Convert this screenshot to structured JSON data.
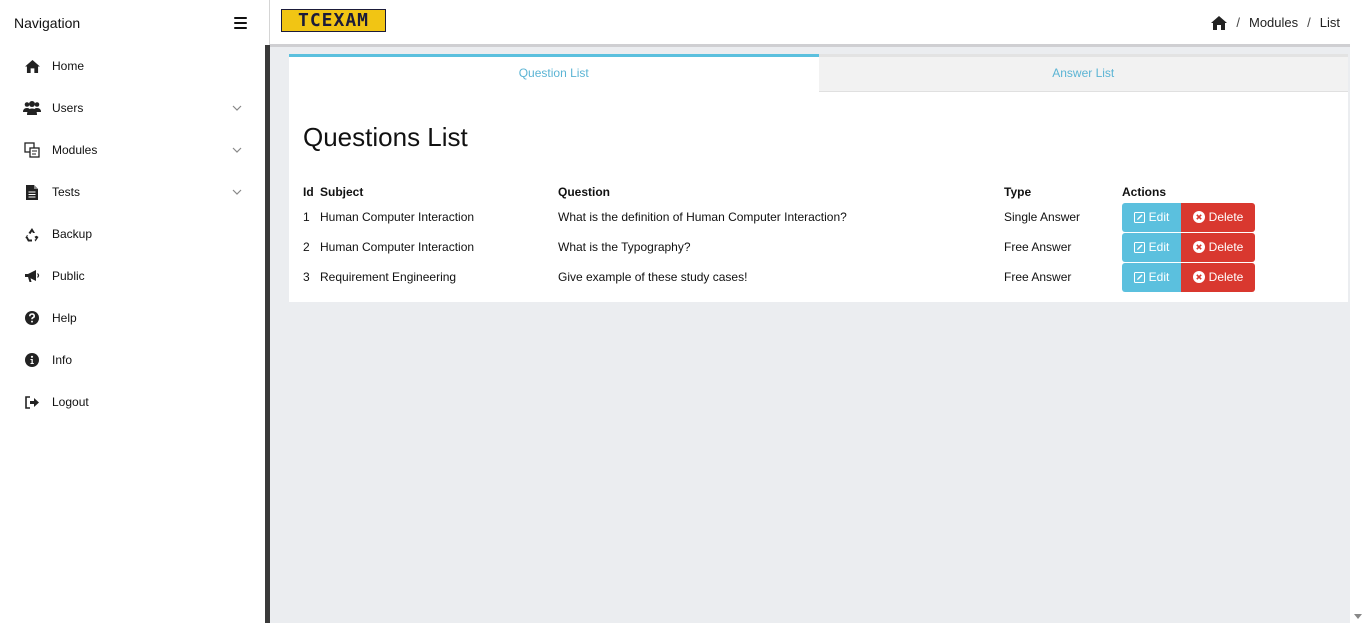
{
  "sidebar": {
    "title": "Navigation",
    "items": [
      {
        "label": "Home",
        "icon": "home-icon"
      },
      {
        "label": "Users",
        "icon": "users-icon",
        "expandable": true
      },
      {
        "label": "Modules",
        "icon": "modules-icon",
        "expandable": true
      },
      {
        "label": "Tests",
        "icon": "file-icon",
        "expandable": true
      },
      {
        "label": "Backup",
        "icon": "recycle-icon"
      },
      {
        "label": "Public",
        "icon": "megaphone-icon"
      },
      {
        "label": "Help",
        "icon": "question-circle-icon"
      },
      {
        "label": "Info",
        "icon": "info-circle-icon"
      },
      {
        "label": "Logout",
        "icon": "sign-out-icon"
      }
    ]
  },
  "header": {
    "logo_text": "TCEXAM",
    "breadcrumb": [
      "Modules",
      "List"
    ]
  },
  "tabs": [
    {
      "label": "Question List",
      "active": true
    },
    {
      "label": "Answer List",
      "active": false
    }
  ],
  "main": {
    "heading": "Questions List",
    "columns": [
      "Id",
      "Subject",
      "Question",
      "Type",
      "Actions"
    ],
    "rows": [
      {
        "id": "1",
        "subject": "Human Computer Interaction",
        "question": "What is the definition of Human Computer Interaction?",
        "type": "Single Answer"
      },
      {
        "id": "2",
        "subject": "Human Computer Interaction",
        "question": "What is the Typography?",
        "type": "Free Answer"
      },
      {
        "id": "3",
        "subject": "Requirement Engineering",
        "question": "Give example of these study cases!",
        "type": "Free Answer"
      }
    ],
    "edit_label": "Edit",
    "delete_label": "Delete"
  },
  "colors": {
    "accent": "#5bc0de",
    "danger": "#d9382f",
    "logo_bg": "#f1c514",
    "main_bg": "#ebedf0"
  }
}
